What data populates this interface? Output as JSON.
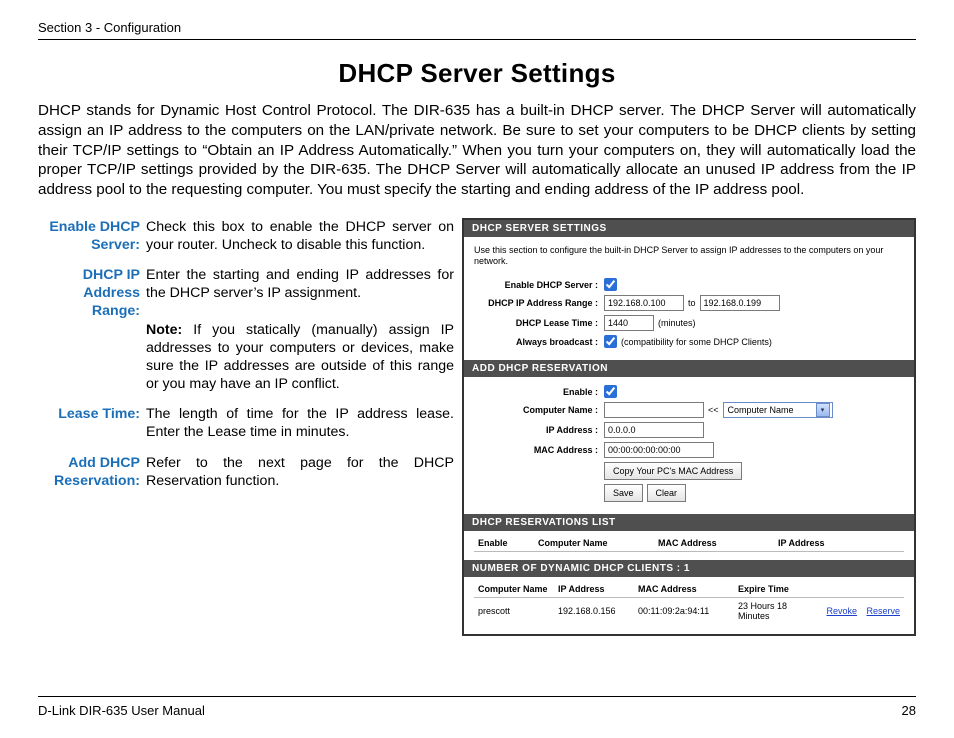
{
  "header": {
    "section": "Section 3 - Configuration"
  },
  "title": "DHCP Server Settings",
  "intro": "DHCP stands for Dynamic Host Control Protocol. The DIR-635 has a built-in DHCP server. The DHCP Server will automatically assign an IP address to the computers on the LAN/private network. Be sure to set your computers to be DHCP clients by setting their TCP/IP settings to “Obtain an IP Address Automatically.” When you turn your computers on, they will automatically load the proper TCP/IP settings provided by the DIR-635. The DHCP Server will automatically allocate an unused IP address from the IP address pool to the requesting computer. You must specify the starting and ending address of the IP address pool.",
  "defs": [
    {
      "term": "Enable DHCP Server:",
      "desc": "Check this box to enable the DHCP server on your router. Uncheck to disable this function."
    },
    {
      "term": "DHCP IP Address Range:",
      "desc": "Enter the starting and ending IP addresses for the DHCP server’s IP assignment.",
      "note": "Note:",
      "note_body": " If you statically (manually) assign IP addresses to your computers or devices, make sure the IP addresses are outside of this range or you may have an IP conflict."
    },
    {
      "term": "Lease Time:",
      "desc": "The length of time for the IP address lease. Enter the Lease time in minutes."
    },
    {
      "term": "Add DHCP Reservation:",
      "desc": "Refer to the next page for the DHCP Reservation function."
    }
  ],
  "panel": {
    "dhcp_settings": {
      "head": "DHCP SERVER SETTINGS",
      "help": "Use this section to configure the built-in DHCP Server to assign IP addresses to the computers on your network.",
      "enable_label": "Enable DHCP Server :",
      "range_label": "DHCP IP Address Range :",
      "range_start": "192.168.0.100",
      "range_to": "to",
      "range_end": "192.168.0.199",
      "lease_label": "DHCP Lease Time :",
      "lease_value": "1440",
      "lease_unit": "(minutes)",
      "always_label": "Always broadcast :",
      "always_hint": "(compatibility for some DHCP Clients)"
    },
    "add_res": {
      "head": "ADD DHCP RESERVATION",
      "enable_label": "Enable :",
      "name_label": "Computer Name :",
      "name_value": "",
      "ll": "<<",
      "select_text": "Computer Name",
      "ip_label": "IP Address :",
      "ip_value": "0.0.0.0",
      "mac_label": "MAC Address :",
      "mac_value": "00:00:00:00:00:00",
      "copy_btn": "Copy Your PC's MAC Address",
      "save_btn": "Save",
      "clear_btn": "Clear"
    },
    "reslist": {
      "head": "DHCP RESERVATIONS LIST",
      "cols": [
        "Enable",
        "Computer Name",
        "MAC Address",
        "IP Address"
      ]
    },
    "dyn": {
      "head": "NUMBER OF DYNAMIC DHCP CLIENTS : 1",
      "cols": [
        "Computer Name",
        "IP Address",
        "MAC Address",
        "Expire Time"
      ],
      "row": {
        "name": "prescott",
        "ip": "192.168.0.156",
        "mac": "00:11:09:2a:94:11",
        "exp": "23 Hours 18 Minutes",
        "revoke": "Revoke",
        "reserve": "Reserve"
      }
    }
  },
  "footer": {
    "left": "D-Link DIR-635 User Manual",
    "right": "28"
  }
}
